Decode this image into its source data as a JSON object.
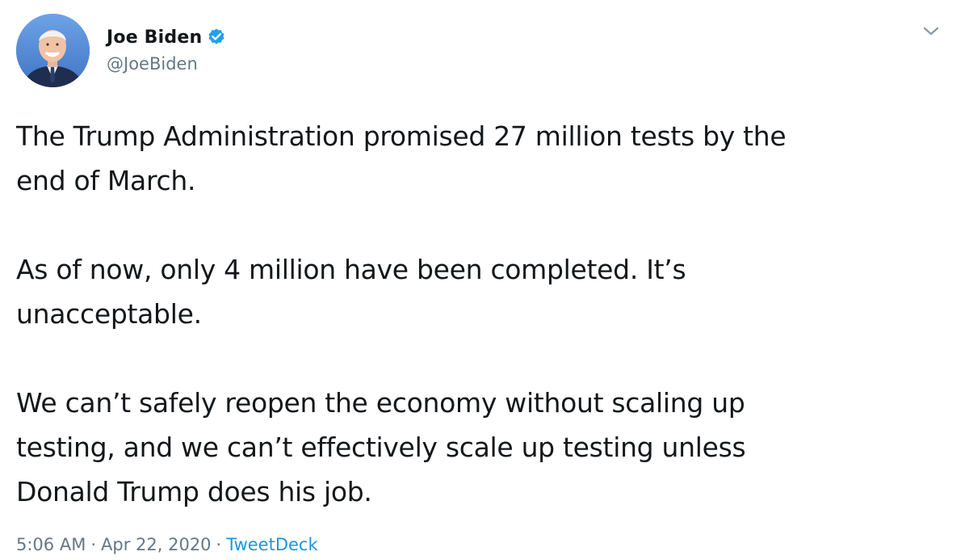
{
  "author": {
    "display_name": "Joe Biden",
    "handle": "@JoeBiden",
    "verified": true
  },
  "tweet": {
    "paragraphs": [
      "The Trump Administration promised 27 million tests by the\nend of March.",
      "As of now, only 4 million have been completed. It’s\nunacceptable.",
      "We can’t safely reopen the economy without scaling up\ntesting, and we can’t effectively scale up testing unless\nDonald Trump does his job."
    ],
    "time": "5:06 AM",
    "date": "Apr 22, 2020",
    "source": "TweetDeck",
    "separator": "·"
  },
  "icons": {
    "verified": "verified-badge-icon",
    "menu": "chevron-down-icon"
  },
  "colors": {
    "text": "#14171a",
    "secondary": "#657786",
    "accent": "#1da1f2"
  }
}
